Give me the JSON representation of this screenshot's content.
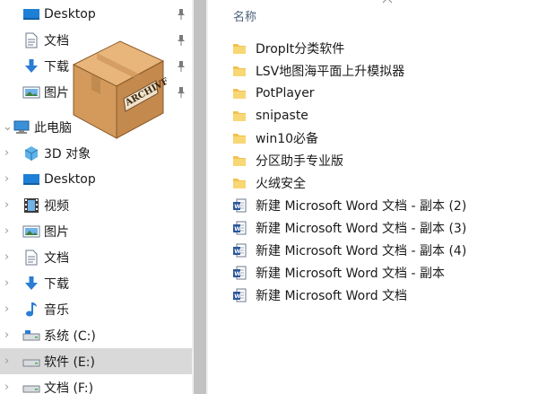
{
  "nav": {
    "items": [
      {
        "label": "Desktop",
        "icon": "desktop-icon",
        "pinned": true
      },
      {
        "label": "文档",
        "icon": "documents-icon",
        "pinned": true
      },
      {
        "label": "下载",
        "icon": "downloads-icon",
        "pinned": true
      },
      {
        "label": "图片",
        "icon": "pictures-icon",
        "pinned": true
      },
      {
        "label": "此电脑",
        "icon": "this-pc-icon"
      },
      {
        "label": "3D 对象",
        "icon": "3d-objects-icon"
      },
      {
        "label": "Desktop",
        "icon": "desktop-icon"
      },
      {
        "label": "视频",
        "icon": "videos-icon"
      },
      {
        "label": "图片",
        "icon": "pictures-icon"
      },
      {
        "label": "文档",
        "icon": "documents-icon"
      },
      {
        "label": "下载",
        "icon": "downloads-icon"
      },
      {
        "label": "音乐",
        "icon": "music-icon"
      },
      {
        "label": "系统 (C:)",
        "icon": "drive-icon"
      },
      {
        "label": "软件 (E:)",
        "icon": "drive-icon",
        "selected": true
      },
      {
        "label": "文档 (F:)",
        "icon": "drive-icon"
      }
    ]
  },
  "overlay": {
    "archive_text": "ARCHIVE",
    "icon": "archive-box-icon"
  },
  "content": {
    "column_header": "名称",
    "files": [
      {
        "name": "DropIt分类软件",
        "type": "folder"
      },
      {
        "name": "LSV地图海平面上升模拟器",
        "type": "folder"
      },
      {
        "name": "PotPlayer",
        "type": "folder"
      },
      {
        "name": "snipaste",
        "type": "folder"
      },
      {
        "name": "win10必备",
        "type": "folder"
      },
      {
        "name": "分区助手专业版",
        "type": "folder"
      },
      {
        "name": "火绒安全",
        "type": "folder"
      },
      {
        "name": "新建 Microsoft Word 文档 - 副本 (2)",
        "type": "word"
      },
      {
        "name": "新建 Microsoft Word 文档 - 副本 (3)",
        "type": "word"
      },
      {
        "name": "新建 Microsoft Word 文档 - 副本 (4)",
        "type": "word"
      },
      {
        "name": "新建 Microsoft Word 文档 - 副本",
        "type": "word"
      },
      {
        "name": "新建 Microsoft Word 文档",
        "type": "word"
      }
    ]
  },
  "colors": {
    "folder": "#f2c14e",
    "word": "#2b579a",
    "selected_bg": "#d9d9d9",
    "header_text": "#4c607a"
  }
}
